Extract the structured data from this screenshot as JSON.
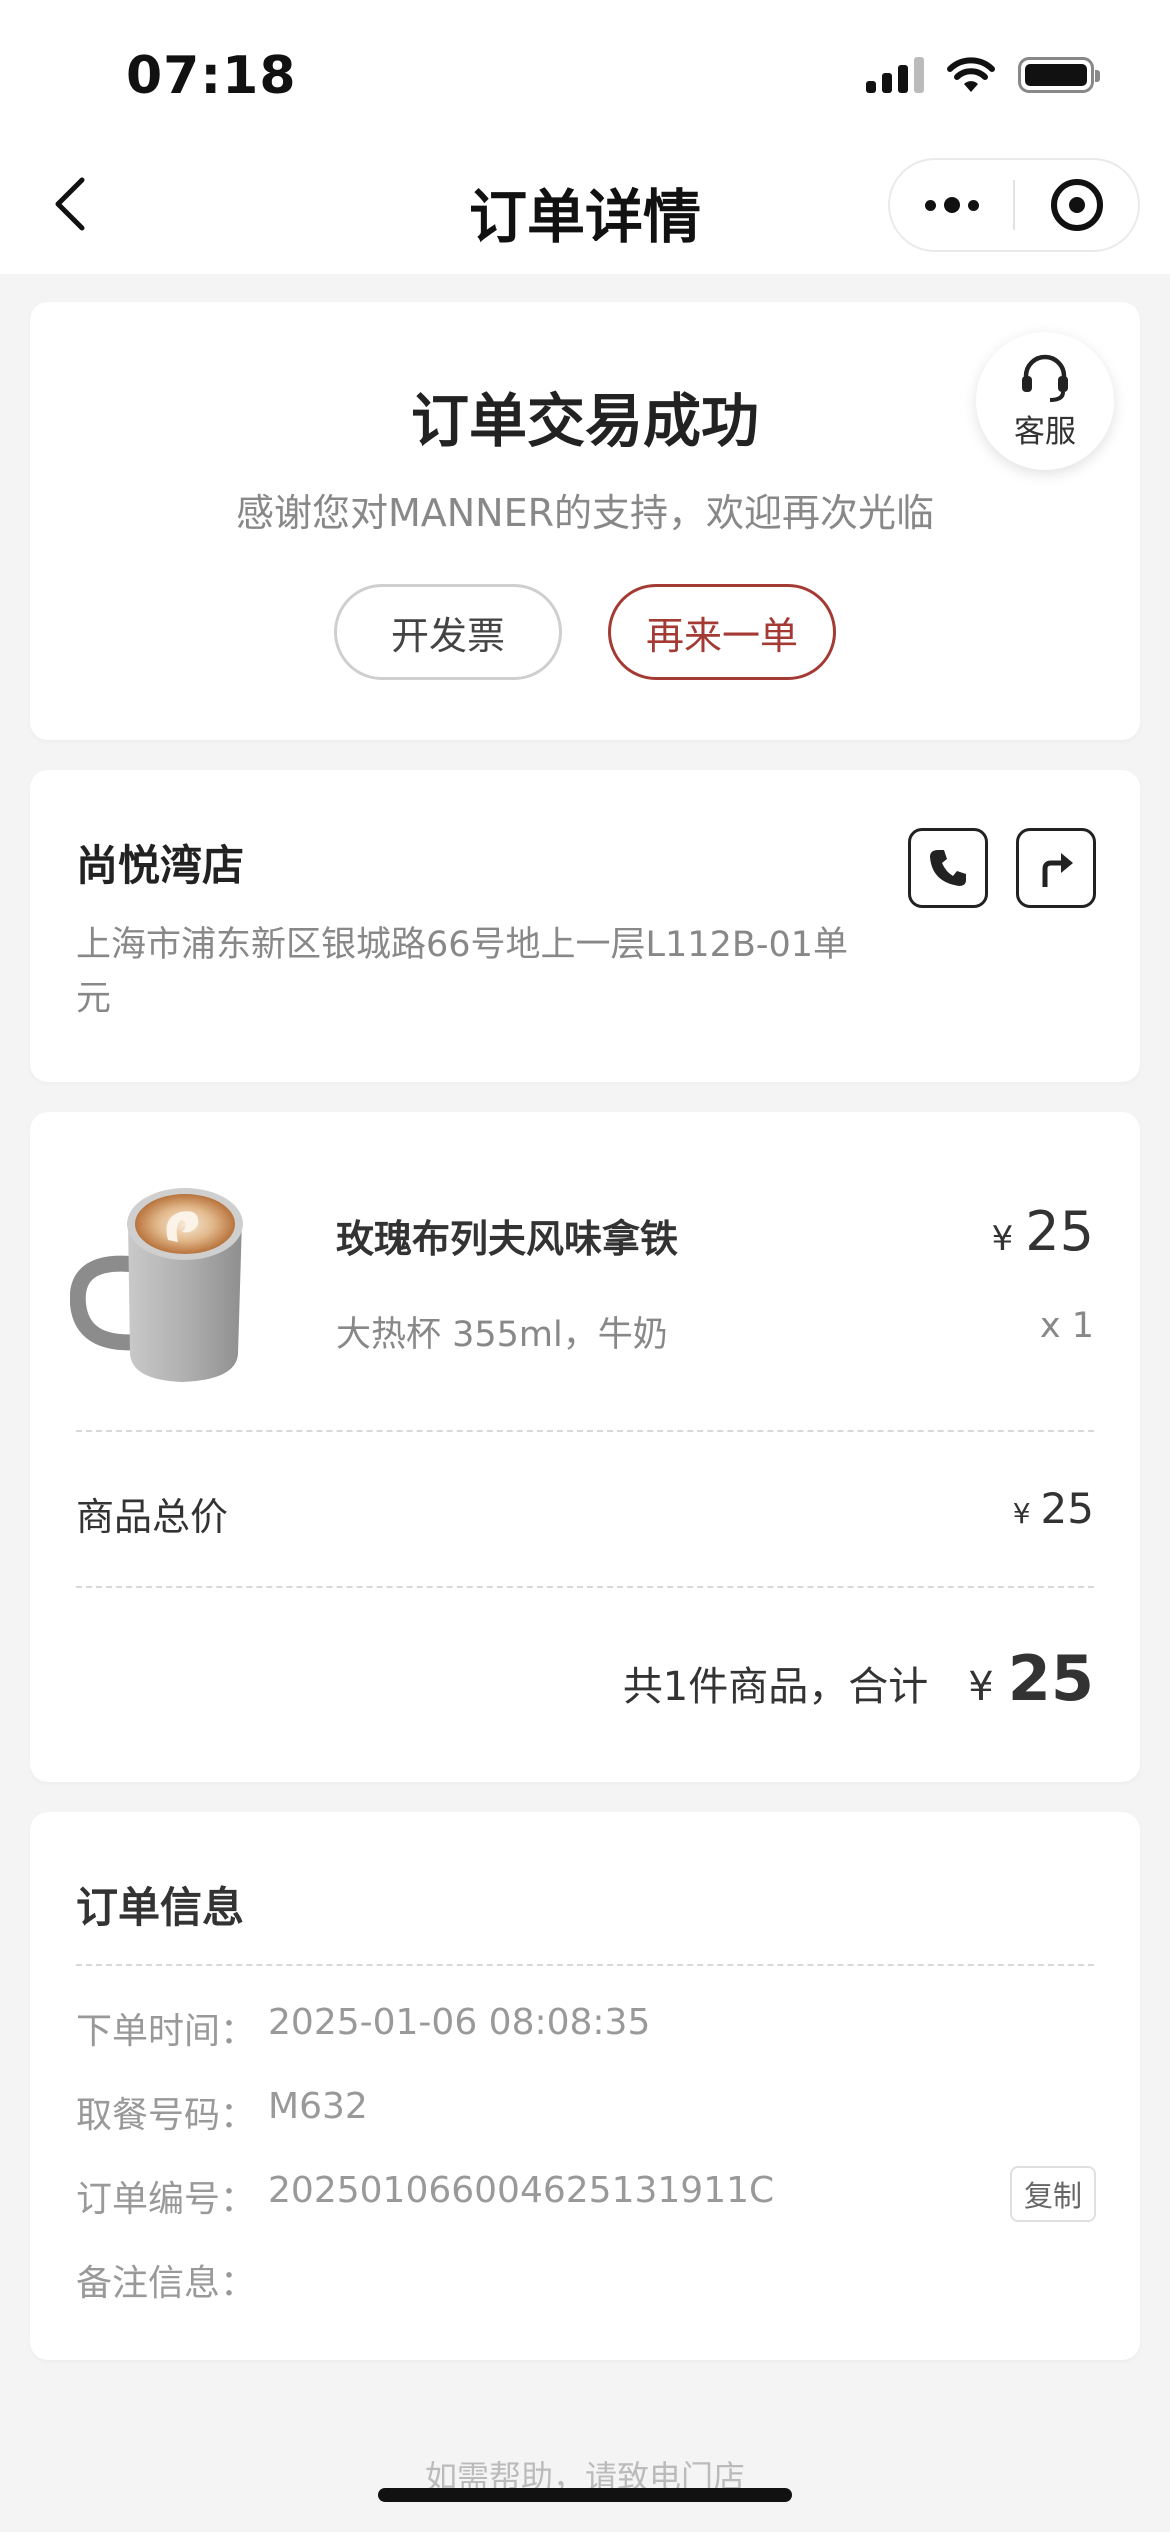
{
  "status_bar": {
    "time": "07:18"
  },
  "nav": {
    "title": "订单详情"
  },
  "order_status": {
    "title": "订单交易成功",
    "subtitle": "感谢您对MANNER的支持，欢迎再次光临",
    "customer_service_label": "客服",
    "invoice_label": "开发票",
    "reorder_label": "再来一单"
  },
  "store": {
    "name": "尚悦湾店",
    "address": "上海市浦东新区银城路66号地上一层L112B-01单元"
  },
  "product": {
    "name": "玫瑰布列夫风味拿铁",
    "spec": "大热杯 355ml，牛奶",
    "currency": "¥",
    "price": "25",
    "quantity": "x 1"
  },
  "summary": {
    "subtotal_label": "商品总价",
    "subtotal_currency": "¥",
    "subtotal_value": "25",
    "total_count": "共1件商品，合计",
    "total_currency": "¥",
    "total_value": "25"
  },
  "order_info": {
    "title": "订单信息",
    "order_time_label": "下单时间：",
    "order_time": "2025-01-06 08:08:35",
    "pickup_label": "取餐号码：",
    "pickup_code": "M632",
    "order_no_label": "订单编号：",
    "order_no": "20250106600462513191​1C",
    "copy_label": "复制",
    "remark_label": "备注信息：",
    "remark": ""
  },
  "footer": {
    "help_text": "如需帮助，请致电门店"
  },
  "colors": {
    "accent": "#a43a34",
    "background": "#f4f4f4"
  }
}
